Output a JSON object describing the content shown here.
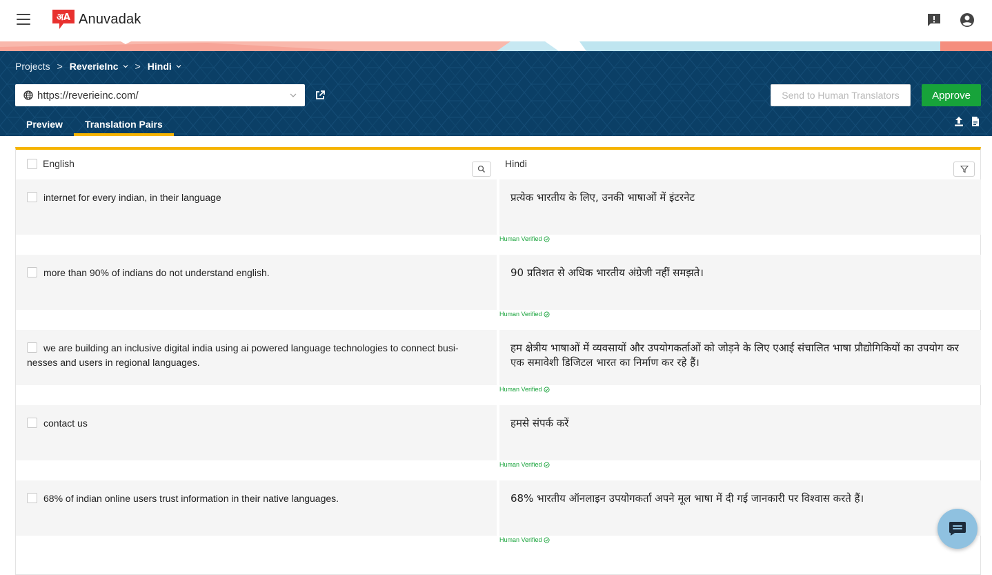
{
  "app": {
    "name": "Anuvadak",
    "logo_glyph": "अA"
  },
  "colors": {
    "band": "#0b3f66",
    "accent": "#f6b400",
    "approve": "#17a33a",
    "verified": "#17a33a"
  },
  "breadcrumb": {
    "projects": "Projects",
    "sep1": ">",
    "project": "ReverieInc",
    "sep2": ">",
    "language": "Hindi"
  },
  "url_select": {
    "value": "https://reverieinc.com/"
  },
  "actions": {
    "send": "Send to Human Translators",
    "approve": "Approve"
  },
  "tabs": [
    {
      "label": "Preview"
    },
    {
      "label": "Translation Pairs"
    }
  ],
  "table": {
    "source_header": "English",
    "target_header": "Hindi",
    "rows": [
      {
        "source": "internet for every indian, in their language",
        "target": "प्रत्येक भारतीय के लिए, उनकी भाषाओं में इंटरनेट",
        "status": "Human Verified"
      },
      {
        "source": "more than 90% of indians do not understand english.",
        "target": "90 प्रतिशत से अधिक भारतीय अंग्रेजी नहीं समझते।",
        "status": "Human Verified"
      },
      {
        "source": "we are building an inclusive digital india using ai powered language technologies to connect busi-nesses and users in regional languages.",
        "target": "हम क्षेत्रीय भाषाओं में व्यवसायों और उपयोगकर्ताओं को जोड़ने के लिए एआई संचालित भाषा प्रौद्योगिकियों का उपयोग कर एक समावेशी डिजिटल भारत का निर्माण कर रहे हैं।",
        "status": "Human Verified"
      },
      {
        "source": "contact us",
        "target": "हमसे संपर्क करें",
        "status": "Human Verified"
      },
      {
        "source": "68% of indian online users trust information in their native languages.",
        "target": "68% भारतीय ऑनलाइन उपयोगकर्ता अपने मूल भाषा में दी गई जानकारी पर विश्वास करते हैं।",
        "status": "Human Verified"
      }
    ]
  },
  "icons": {
    "menu": "hamburger-menu-icon",
    "feedback": "feedback-icon",
    "account": "account-icon",
    "globe": "globe-icon",
    "external": "external-link-icon",
    "upload": "upload-icon",
    "document": "document-icon",
    "search": "search-icon",
    "filter": "filter-icon",
    "check": "check-circle-icon",
    "chat": "chat-icon"
  }
}
